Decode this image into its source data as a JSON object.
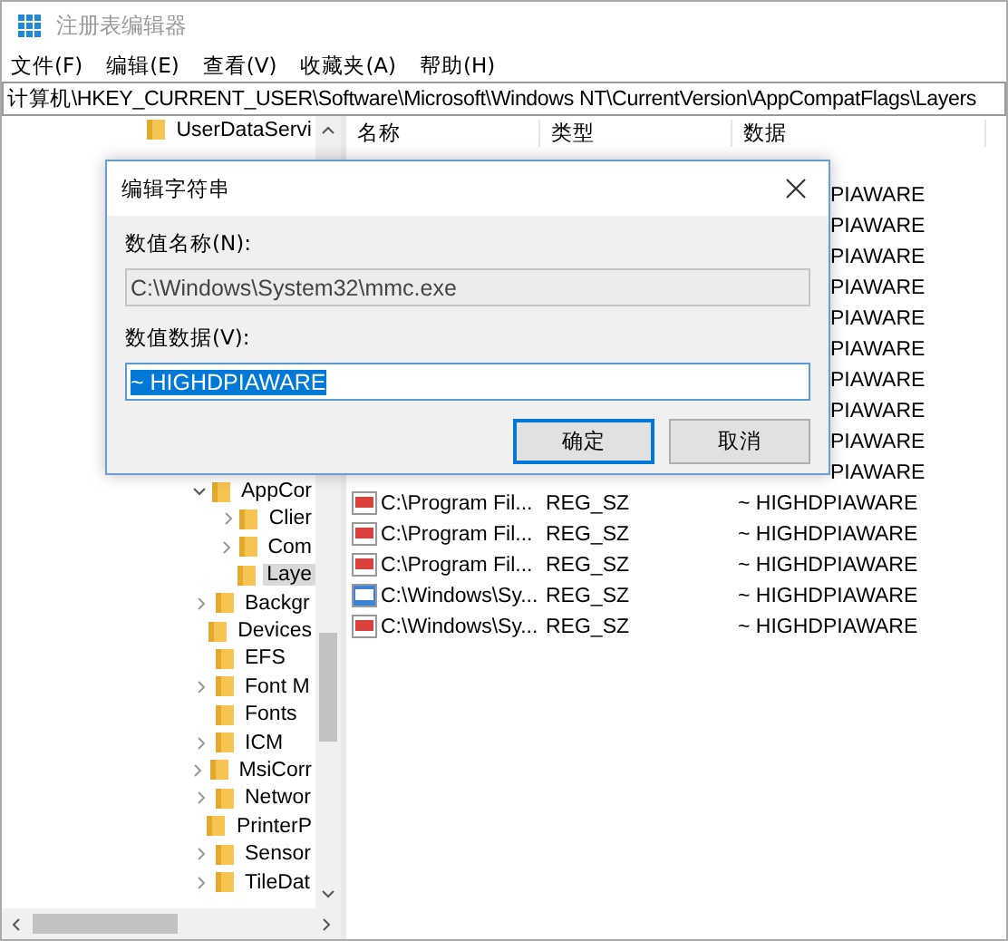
{
  "window": {
    "title": "注册表编辑器"
  },
  "menu": [
    {
      "label": "文件(F)"
    },
    {
      "label": "编辑(E)"
    },
    {
      "label": "查看(V)"
    },
    {
      "label": "收藏夹(A)"
    },
    {
      "label": "帮助(H)"
    }
  ],
  "address": "计算机\\HKEY_CURRENT_USER\\Software\\Microsoft\\Windows NT\\CurrentVersion\\AppCompatFlags\\Layers",
  "tree": {
    "top_items": [
      {
        "label": "UserDataServi",
        "selected": false
      }
    ],
    "items": [
      {
        "label": "AppCor",
        "expanded": true,
        "selected": false,
        "children": [
          {
            "label": "Clier",
            "expanded": false,
            "selected": false
          },
          {
            "label": "Com",
            "expanded": false,
            "selected": false
          },
          {
            "label": "Laye",
            "selected": true
          }
        ]
      },
      {
        "label": "Backgr",
        "expanded": false,
        "selected": false
      },
      {
        "label": "Devices",
        "selected": false
      },
      {
        "label": "EFS",
        "selected": false
      },
      {
        "label": "Font M",
        "expanded": false,
        "selected": false
      },
      {
        "label": "Fonts",
        "selected": false
      },
      {
        "label": "ICM",
        "expanded": false,
        "selected": false
      },
      {
        "label": "MsiCorr",
        "expanded": false,
        "selected": false
      },
      {
        "label": "Networ",
        "expanded": false,
        "selected": false
      },
      {
        "label": "PrinterP",
        "selected": false
      },
      {
        "label": "Sensor",
        "expanded": false,
        "selected": false
      },
      {
        "label": "TileDat",
        "expanded": false,
        "selected": false
      }
    ]
  },
  "list": {
    "columns": [
      "名称",
      "类型",
      "数据"
    ],
    "rows": [
      {
        "kind": "partial",
        "data": "PIAWARE"
      },
      {
        "kind": "partial",
        "data": "PIAWARE"
      },
      {
        "kind": "partial",
        "data": "PIAWARE"
      },
      {
        "kind": "partial",
        "data": "PIAWARE"
      },
      {
        "kind": "partial",
        "data": "PIAWARE"
      },
      {
        "kind": "partial",
        "data": "PIAWARE"
      },
      {
        "kind": "partial",
        "data": "PIAWARE"
      },
      {
        "kind": "partial",
        "data": "PIAWARE"
      },
      {
        "kind": "partial",
        "data": "PIAWARE"
      },
      {
        "kind": "partial",
        "data": "PIAWARE"
      },
      {
        "kind": "full",
        "name": "C:\\Program Fil...",
        "type": "REG_SZ",
        "data": "~ HIGHDPIAWARE",
        "focused": false
      },
      {
        "kind": "full",
        "name": "C:\\Program Fil...",
        "type": "REG_SZ",
        "data": "~ HIGHDPIAWARE",
        "focused": false
      },
      {
        "kind": "full",
        "name": "C:\\Program Fil...",
        "type": "REG_SZ",
        "data": "~ HIGHDPIAWARE",
        "focused": false
      },
      {
        "kind": "full",
        "name": "C:\\Windows\\Sy...",
        "type": "REG_SZ",
        "data": "~ HIGHDPIAWARE",
        "focused": true
      },
      {
        "kind": "full",
        "name": "C:\\Windows\\Sy...",
        "type": "REG_SZ",
        "data": "~ HIGHDPIAWARE",
        "focused": false
      }
    ]
  },
  "dialog": {
    "title": "编辑字符串",
    "name_label": "数值名称(N):",
    "name_value": "C:\\Windows\\System32\\mmc.exe",
    "data_label": "数值数据(V):",
    "data_value": "~ HIGHDPIAWARE",
    "data_selected": true,
    "buttons": [
      {
        "label": "确定",
        "default": true
      },
      {
        "label": "取消",
        "default": false
      }
    ]
  }
}
